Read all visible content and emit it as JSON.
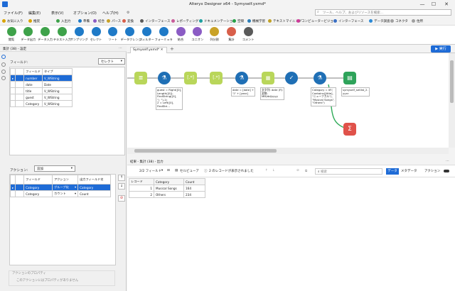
{
  "window": {
    "title": "Alteryx Designer x64 - Symyself.yxmd*",
    "minimize": "—",
    "maximize": "☐",
    "close": "✕"
  },
  "menu": [
    {
      "label": "ファイル(F)"
    },
    {
      "label": "編集(E)"
    },
    {
      "label": "表示(V)"
    },
    {
      "label": "オプション(O)"
    },
    {
      "label": "ヘルプ(H)"
    }
  ],
  "help_search": {
    "placeholder": "ツール、ヘルプ、およびリソースを検索..."
  },
  "categories": [
    {
      "label": "お気に入り",
      "color": "#d9a400"
    },
    {
      "label": "推奨",
      "color": "#d9a400"
    },
    {
      "label": "入出力",
      "color": "#3ea24a"
    },
    {
      "label": "準備",
      "color": "#1f7ac7"
    },
    {
      "label": "結合",
      "color": "#8b5cc4"
    },
    {
      "label": "パース",
      "color": "#c9a227"
    },
    {
      "label": "変換",
      "color": "#d85f4a"
    },
    {
      "label": "インターフェース",
      "color": "#5a5a5a"
    },
    {
      "label": "レポーティング",
      "color": "#c95d9a"
    },
    {
      "label": "ドキュメンテーション",
      "color": "#1ea0a0"
    },
    {
      "label": "空間",
      "color": "#24a046"
    },
    {
      "label": "機械学習",
      "color": "#2d7fb8"
    },
    {
      "label": "テキストマイニング",
      "color": "#c2a227"
    },
    {
      "label": "コンピュータービジョン",
      "color": "#d03a9a"
    },
    {
      "label": "インターフェース",
      "color": "#3a6fc4"
    },
    {
      "label": "データ調査",
      "color": "#2b8ad6"
    },
    {
      "label": "コネクタ",
      "color": "#a0a0a0"
    },
    {
      "label": "住所",
      "color": "#a0a0a0"
    }
  ],
  "tools": [
    {
      "label": "閲覧",
      "color": "#3ea24a"
    },
    {
      "label": "データ出力",
      "color": "#3ea24a"
    },
    {
      "label": "データ入力",
      "color": "#3ea24a"
    },
    {
      "label": "テキスト入力",
      "color": "#3ea24a"
    },
    {
      "label": "サンプリング",
      "color": "#1f7ac7"
    },
    {
      "label": "セレクト",
      "color": "#1f7ac7"
    },
    {
      "label": "ソート",
      "color": "#1f7ac7"
    },
    {
      "label": "データクレンジ...",
      "color": "#1f7ac7"
    },
    {
      "label": "フィルター",
      "color": "#1f7ac7"
    },
    {
      "label": "フォーミュラ",
      "color": "#1f7ac7"
    },
    {
      "label": "結合",
      "color": "#8b5cc4"
    },
    {
      "label": "ユニオン",
      "color": "#8b5cc4"
    },
    {
      "label": "列分割",
      "color": "#c9a227"
    },
    {
      "label": "集計",
      "color": "#d85f4a"
    },
    {
      "label": "コメント",
      "color": "#5a5a5a"
    }
  ],
  "config": {
    "header": "集計 (38) - 設定",
    "fields_label": "フィールド:",
    "select_value": "セレクト",
    "fields_columns": [
      "フィールド",
      "タイプ"
    ],
    "fields": [
      {
        "name": "number",
        "type": "V_WString",
        "selected": true
      },
      {
        "name": "date",
        "type": "Date",
        "selected": false
      },
      {
        "name": "title",
        "type": "V_WString",
        "selected": false
      },
      {
        "name": "guest",
        "type": "V_WString",
        "selected": false
      },
      {
        "name": "Category",
        "type": "V_WString",
        "selected": false
      }
    ],
    "actions_label": "アクション:",
    "add_value": "追加",
    "actions_columns": [
      "フィールド",
      "アクション",
      "出力フィールド名"
    ],
    "actions": [
      {
        "field": "Category",
        "action": "グループ化",
        "output": "Category",
        "selected": true
      },
      {
        "field": "Category",
        "action": "カウント",
        "output": "Count",
        "selected": false
      }
    ],
    "properties_title": "アクションのプロパティ",
    "properties_text": "このアクションにはプロパティがありません"
  },
  "canvas": {
    "tab": "Symyself.yxmd*",
    "add_tab": "+",
    "run_button": "実行",
    "annotations": [
      "guest = Right([0],\nLength([0])-\nFindString([0],\n\"」\")-1)\n2 = Left([0],\nFindStri...",
      "date = [date] +\n\"/\" + [year]",
      "文字列: date (Fi)\n変数:\nMM/dd/yyyy",
      "Category = IIF(\nContains([title],\n\"ニューフカル\"),\n\"Musical Songs\",\n\"Others\")",
      "symyself_setlist_2.\nyyxr"
    ]
  },
  "results": {
    "header": "結果 - 集計 (38) - 出力",
    "field_count": "2/2 フィールド",
    "cell_viewer": "セルビューア",
    "records_shown": "2 のレコードが表示されました",
    "search_placeholder": "検索",
    "tab_data": "データ",
    "tab_metadata": "メタデータ",
    "actions_label": "アクション",
    "columns": [
      "レコード",
      "Category",
      "Count"
    ],
    "rows": [
      [
        "1",
        "Musical Songs",
        "164"
      ],
      [
        "2",
        "Others",
        "234"
      ]
    ]
  }
}
